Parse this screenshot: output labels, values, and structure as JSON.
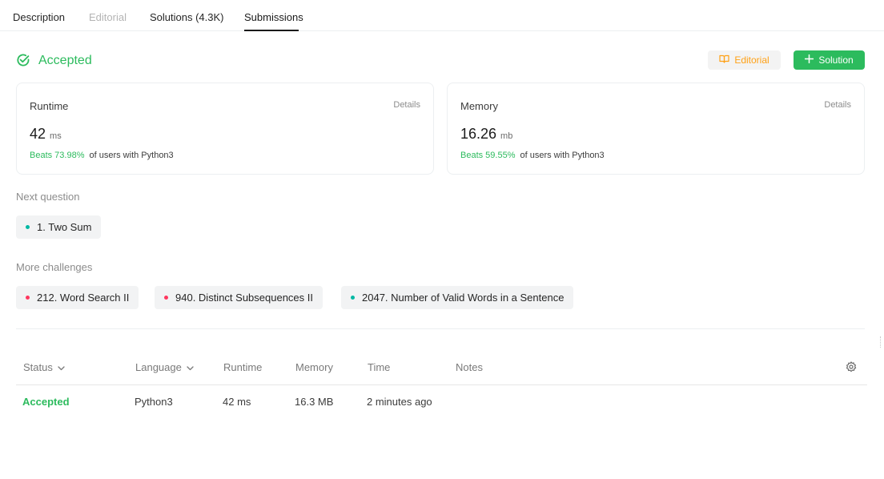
{
  "tabs": [
    {
      "label": "Description",
      "state": "normal"
    },
    {
      "label": "Editorial",
      "state": "disabled"
    },
    {
      "label": "Solutions (4.3K)",
      "state": "normal"
    },
    {
      "label": "Submissions",
      "state": "active"
    }
  ],
  "result": {
    "status": "Accepted",
    "status_icon": "check-circle-icon",
    "editorial_button": "Editorial",
    "solution_button": "Solution"
  },
  "runtime": {
    "label": "Runtime",
    "details": "Details",
    "value": "42",
    "unit": "ms",
    "beats": "Beats 73.98%",
    "beats_suffix": "of users with Python3"
  },
  "memory": {
    "label": "Memory",
    "details": "Details",
    "value": "16.26",
    "unit": "mb",
    "beats": "Beats 59.55%",
    "beats_suffix": "of users with Python3"
  },
  "next_question": {
    "label": "Next question",
    "items": [
      {
        "title": "1. Two Sum",
        "difficulty": "easy"
      }
    ]
  },
  "more_challenges": {
    "label": "More challenges",
    "items": [
      {
        "title": "212. Word Search II",
        "difficulty": "hard"
      },
      {
        "title": "940. Distinct Subsequences II",
        "difficulty": "hard"
      },
      {
        "title": "2047. Number of Valid Words in a Sentence",
        "difficulty": "easy"
      }
    ]
  },
  "table": {
    "headers": {
      "status": "Status",
      "language": "Language",
      "runtime": "Runtime",
      "memory": "Memory",
      "time": "Time",
      "notes": "Notes"
    },
    "rows": [
      {
        "status": "Accepted",
        "language": "Python3",
        "runtime": "42 ms",
        "memory": "16.3 MB",
        "time": "2 minutes ago",
        "notes": ""
      }
    ]
  },
  "colors": {
    "accent_green": "#2cbb5d",
    "editorial_orange": "#ffa116",
    "easy": "#00b8a3",
    "hard": "#ff375f"
  }
}
